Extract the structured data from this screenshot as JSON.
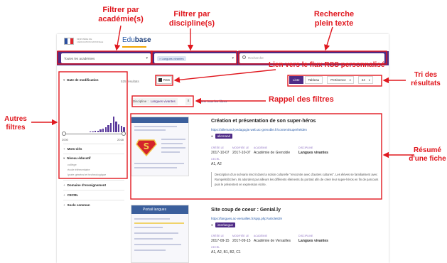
{
  "annotations": {
    "filtrer_academie": "Filtrer par\nacadémie(s)",
    "filtrer_discipline": "Filtrer par\ndiscipline(s)",
    "recherche": "Recherche\nplein texte",
    "lien_rss": "Lien vers le flux RSS personnalisé",
    "tri": "Tri des\nrésultats",
    "rappel": "Rappel des filtres",
    "autres_filtres": "Autres\nfiltres",
    "resume": "Résumé\nd'une fiche"
  },
  "colors": {
    "annotation": "#e0181f",
    "purple": "#4f2b86",
    "link": "#2a5ca8"
  },
  "header": {
    "brand_prefix": "Edu",
    "brand_suffix": "base",
    "ministry": "MINISTÈRE DE L'ÉDUCATION NATIONALE"
  },
  "searchbar": {
    "academie_value": "Toutes les académies",
    "discipline_tag": "× Langues vivantes",
    "search_placeholder": "Recherche"
  },
  "sidebar": {
    "date_facet": "Date de modification",
    "year_start": "2000",
    "year_end": "2018",
    "histogram": [
      0,
      0,
      0,
      0,
      0,
      0,
      0,
      0,
      0,
      0,
      0.05,
      0.05,
      0.1,
      0.1,
      0.2,
      0.25,
      0.3,
      0.45,
      0.6,
      1.0,
      0.7,
      0.5,
      0.4,
      0.3
    ],
    "motscles": "Mots-clés",
    "niveau": "Niveau éducatif",
    "niveau_items": [
      "collège",
      "école élémentaire",
      "lycée général et technologique"
    ],
    "domaine": "Domaine d'enseignement",
    "cecrl": "CECRL",
    "socle": "Socle commun"
  },
  "results": {
    "count": "525 résultats",
    "rss_label": "RSS",
    "sort_buttons": [
      "Liste",
      "Tableau"
    ],
    "sort_select": "Pertinence",
    "per_page": "24",
    "filter_chip_label": "Discipline :",
    "filter_chip_value": "Langues vivantes",
    "filter_chip_close": "x",
    "clear_all": "Retirer tous les filtres"
  },
  "cards": [
    {
      "title": "Création et présentation de son super-héros",
      "url": "https://allemand-pedagogie.web.ac-grenoble.fr/content/superhelden",
      "tag": "allemand",
      "meta_labels": [
        "CRÉÉE LE",
        "MODIFIÉE LE",
        "ACADÉMIE",
        "DISCIPLINE"
      ],
      "meta_values": [
        "2017-10-07",
        "2017-10-07",
        "Académie de Grenoble",
        "Langues vivantes"
      ],
      "cecrl_label": "CECRL",
      "cecrl_value": "A1, A2",
      "description": "Description d'un scénario inscrit dans la notion culturelle \"rencontre avec d'autres cultures\". Les élèves se familiarisent avec Rumpelstilzchen. Ils abordent par ailleurs les différents éléments du portrait afin de créer leur super-héros en fin de parcours puis le présentent en expression écrite."
    },
    {
      "title": "Site coup de coeur : Genial.ly",
      "url": "https://langues.ac-versailles.fr/spip.php?article829",
      "tag": "interlangue",
      "thumb_title": "Portail langues",
      "meta_labels": [
        "CRÉÉE LE",
        "MODIFIÉE LE",
        "ACADÉMIE",
        "DISCIPLINE"
      ],
      "meta_values": [
        "2017-09-15",
        "2017-09-15",
        "Académie de Versailles",
        "Langues vivantes"
      ],
      "cecrl_label": "CECRL",
      "cecrl_value": "A1, A2, B1, B2, C1"
    }
  ]
}
